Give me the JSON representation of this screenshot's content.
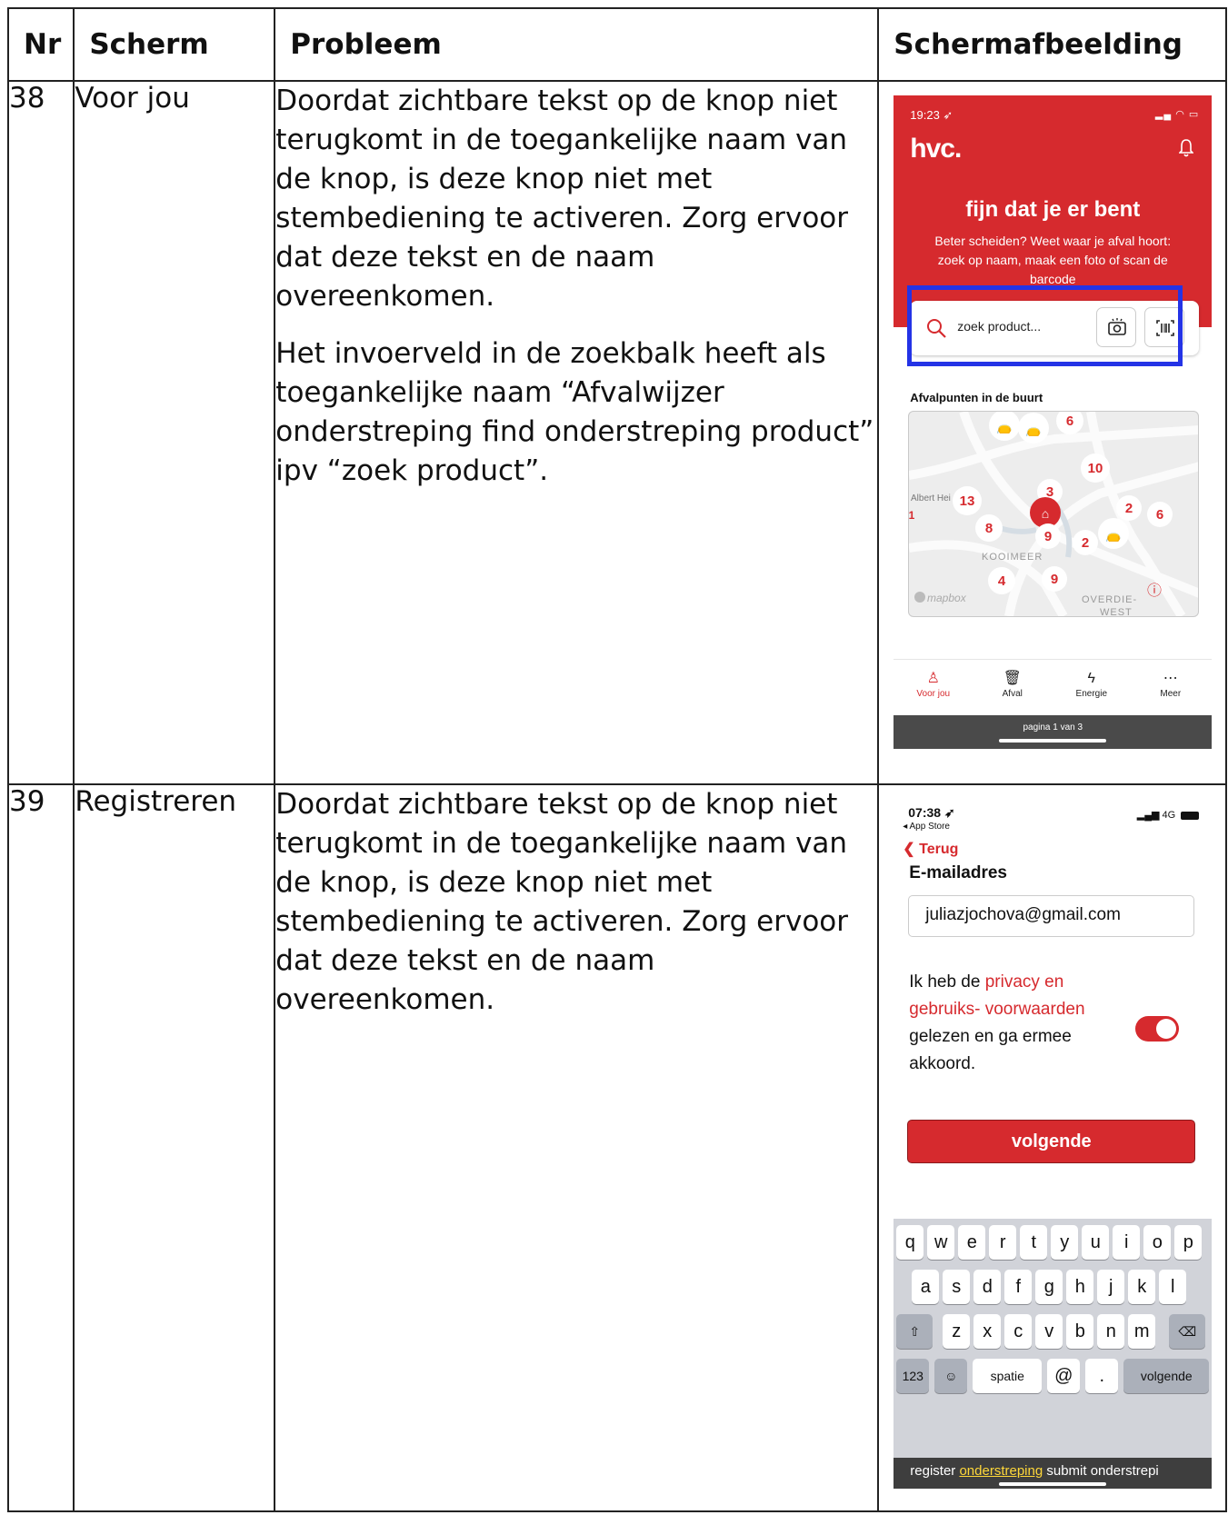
{
  "table": {
    "headers": [
      "Nr",
      "Scherm",
      "Probleem",
      "Schermafbeelding"
    ],
    "rows": [
      {
        "nr": "38",
        "scherm": "Voor jou",
        "probleem": [
          "Doordat zichtbare tekst op de knop niet terugkomt in de toegankelijke naam van de knop, is deze knop niet met stembediening te activeren. Zorg ervoor dat deze tekst en de naam overeenkomen.",
          "Het invoerveld in de zoekbalk heeft als toegankelijke naam “Afvalwijzer onderstreping find onderstreping product” ipv “zoek product”."
        ]
      },
      {
        "nr": "39",
        "scherm": "Registreren",
        "probleem": [
          "Doordat zichtbare tekst op de knop niet terugkomt in de toegankelijke naam van de knop, is deze knop niet met stembediening te activeren. Zorg ervoor dat deze tekst en de naam overeenkomen."
        ]
      }
    ]
  },
  "screenshot1": {
    "time": "19:23 ➶",
    "logo": "hvc.",
    "tagline": "fijn dat je er bent",
    "intro": "Beter scheiden? Weet waar je afval hoort: zoek op naam, maak een foto of scan de barcode",
    "search_placeholder": "zoek product...",
    "section_title": "Afvalpunten in de buurt",
    "map": {
      "area_labels": [
        "KOOIMEER",
        "OVERDIE-",
        "WEST"
      ],
      "store_label": "Albert Hei",
      "attribution": "mapbox",
      "info": "ⓘ",
      "counts": [
        "6",
        "10",
        "13",
        "3",
        "2",
        "6",
        "8",
        "9",
        "2",
        "4",
        "9",
        "1"
      ]
    },
    "nav": [
      "Voor jou",
      "Afval",
      "Energie",
      "Meer"
    ],
    "page_indicator": "pagina 1 van 3",
    "colors": {
      "brand": "#d62a2e",
      "focus_outline": "#2433e6"
    }
  },
  "screenshot2": {
    "time": "07:38 ➶",
    "back_app": "◂ App Store",
    "network": "4G",
    "back_label": "Terug",
    "field_label": "E-mailadres",
    "email_value": "juliazjochova@gmail.com",
    "consent_pre": "Ik heb de ",
    "consent_link": "privacy en gebruiks- voorwaarden",
    "consent_post": " gelezen en ga ermee akkoord.",
    "consent_toggle_on": true,
    "next_button": "volgende",
    "keyboard": {
      "row1": [
        "q",
        "w",
        "e",
        "r",
        "t",
        "y",
        "u",
        "i",
        "o",
        "p"
      ],
      "row2": [
        "a",
        "s",
        "d",
        "f",
        "g",
        "h",
        "j",
        "k",
        "l"
      ],
      "row3": [
        "z",
        "x",
        "c",
        "v",
        "b",
        "n",
        "m"
      ],
      "numbers_key": "123",
      "space_key": "spatie",
      "at_key": "@",
      "dot_key": ".",
      "return_key": "volgende"
    },
    "voice_pre": "register ",
    "voice_highlight": "onderstreping",
    "voice_post": " submit onderstrepi"
  }
}
